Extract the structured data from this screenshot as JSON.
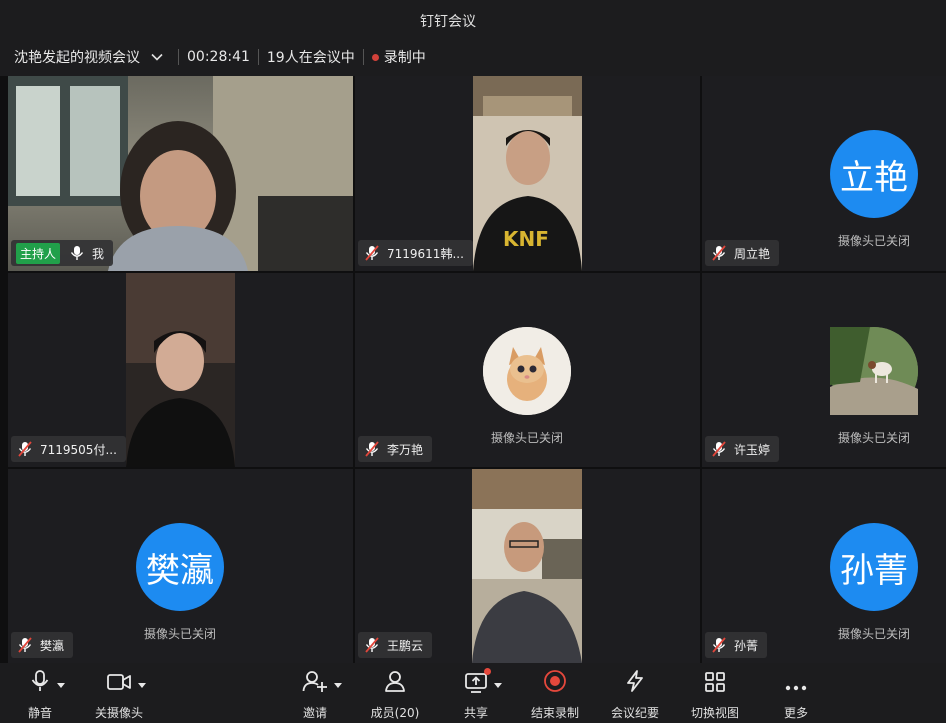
{
  "window": {
    "title": "钉钉会议"
  },
  "info_bar": {
    "meeting_name": "沈艳发起的视频会议",
    "duration": "00:28:41",
    "participants_status": "19人在会议中",
    "recording_status": "录制中"
  },
  "tiles": [
    {
      "name": "我",
      "host_label": "主持人",
      "mic": "on",
      "camera": "on"
    },
    {
      "name": "7119611韩...",
      "mic": "muted",
      "camera": "on"
    },
    {
      "name": "周立艳",
      "mic": "muted",
      "camera": "off",
      "avatar_text": "立艳",
      "camera_off_text": "摄像头已关闭"
    },
    {
      "name": "7119505付...",
      "mic": "muted",
      "camera": "on"
    },
    {
      "name": "李万艳",
      "mic": "muted",
      "camera": "off",
      "avatar": "kitten-photo",
      "camera_off_text": "摄像头已关闭"
    },
    {
      "name": "许玉婷",
      "mic": "muted",
      "camera": "off",
      "avatar": "goat-photo",
      "camera_off_text": "摄像头已关闭"
    },
    {
      "name": "樊瀛",
      "mic": "muted",
      "camera": "off",
      "avatar_text": "樊瀛",
      "camera_off_text": "摄像头已关闭"
    },
    {
      "name": "王鹏云",
      "mic": "muted",
      "camera": "on"
    },
    {
      "name": "孙菁",
      "mic": "muted",
      "camera": "off",
      "avatar_text": "孙菁",
      "camera_off_text": "摄像头已关闭"
    }
  ],
  "toolbar": {
    "mute": "静音",
    "camera_off": "关摄像头",
    "invite": "邀请",
    "members": "成员(20)",
    "share": "共享",
    "end_recording": "结束录制",
    "minutes": "会议纪要",
    "switch_view": "切换视图",
    "more": "更多"
  },
  "colors": {
    "avatar_blue": "#1d8bf1",
    "host_green": "#21a04a",
    "recording_red": "#d2413a",
    "background": "#1a1a1c"
  }
}
